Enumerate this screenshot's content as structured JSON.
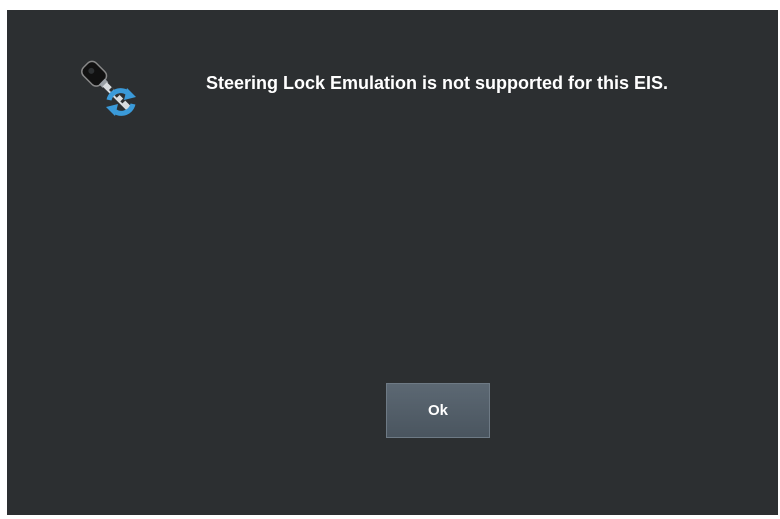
{
  "dialog": {
    "icon": "key-sync-icon",
    "message": "Steering Lock Emulation is not supported for this EIS.",
    "ok_label": "Ok"
  },
  "colors": {
    "background": "#2c2f31",
    "text": "#ffffff",
    "button": "#55606a",
    "icon_accent": "#3a9ad9"
  }
}
